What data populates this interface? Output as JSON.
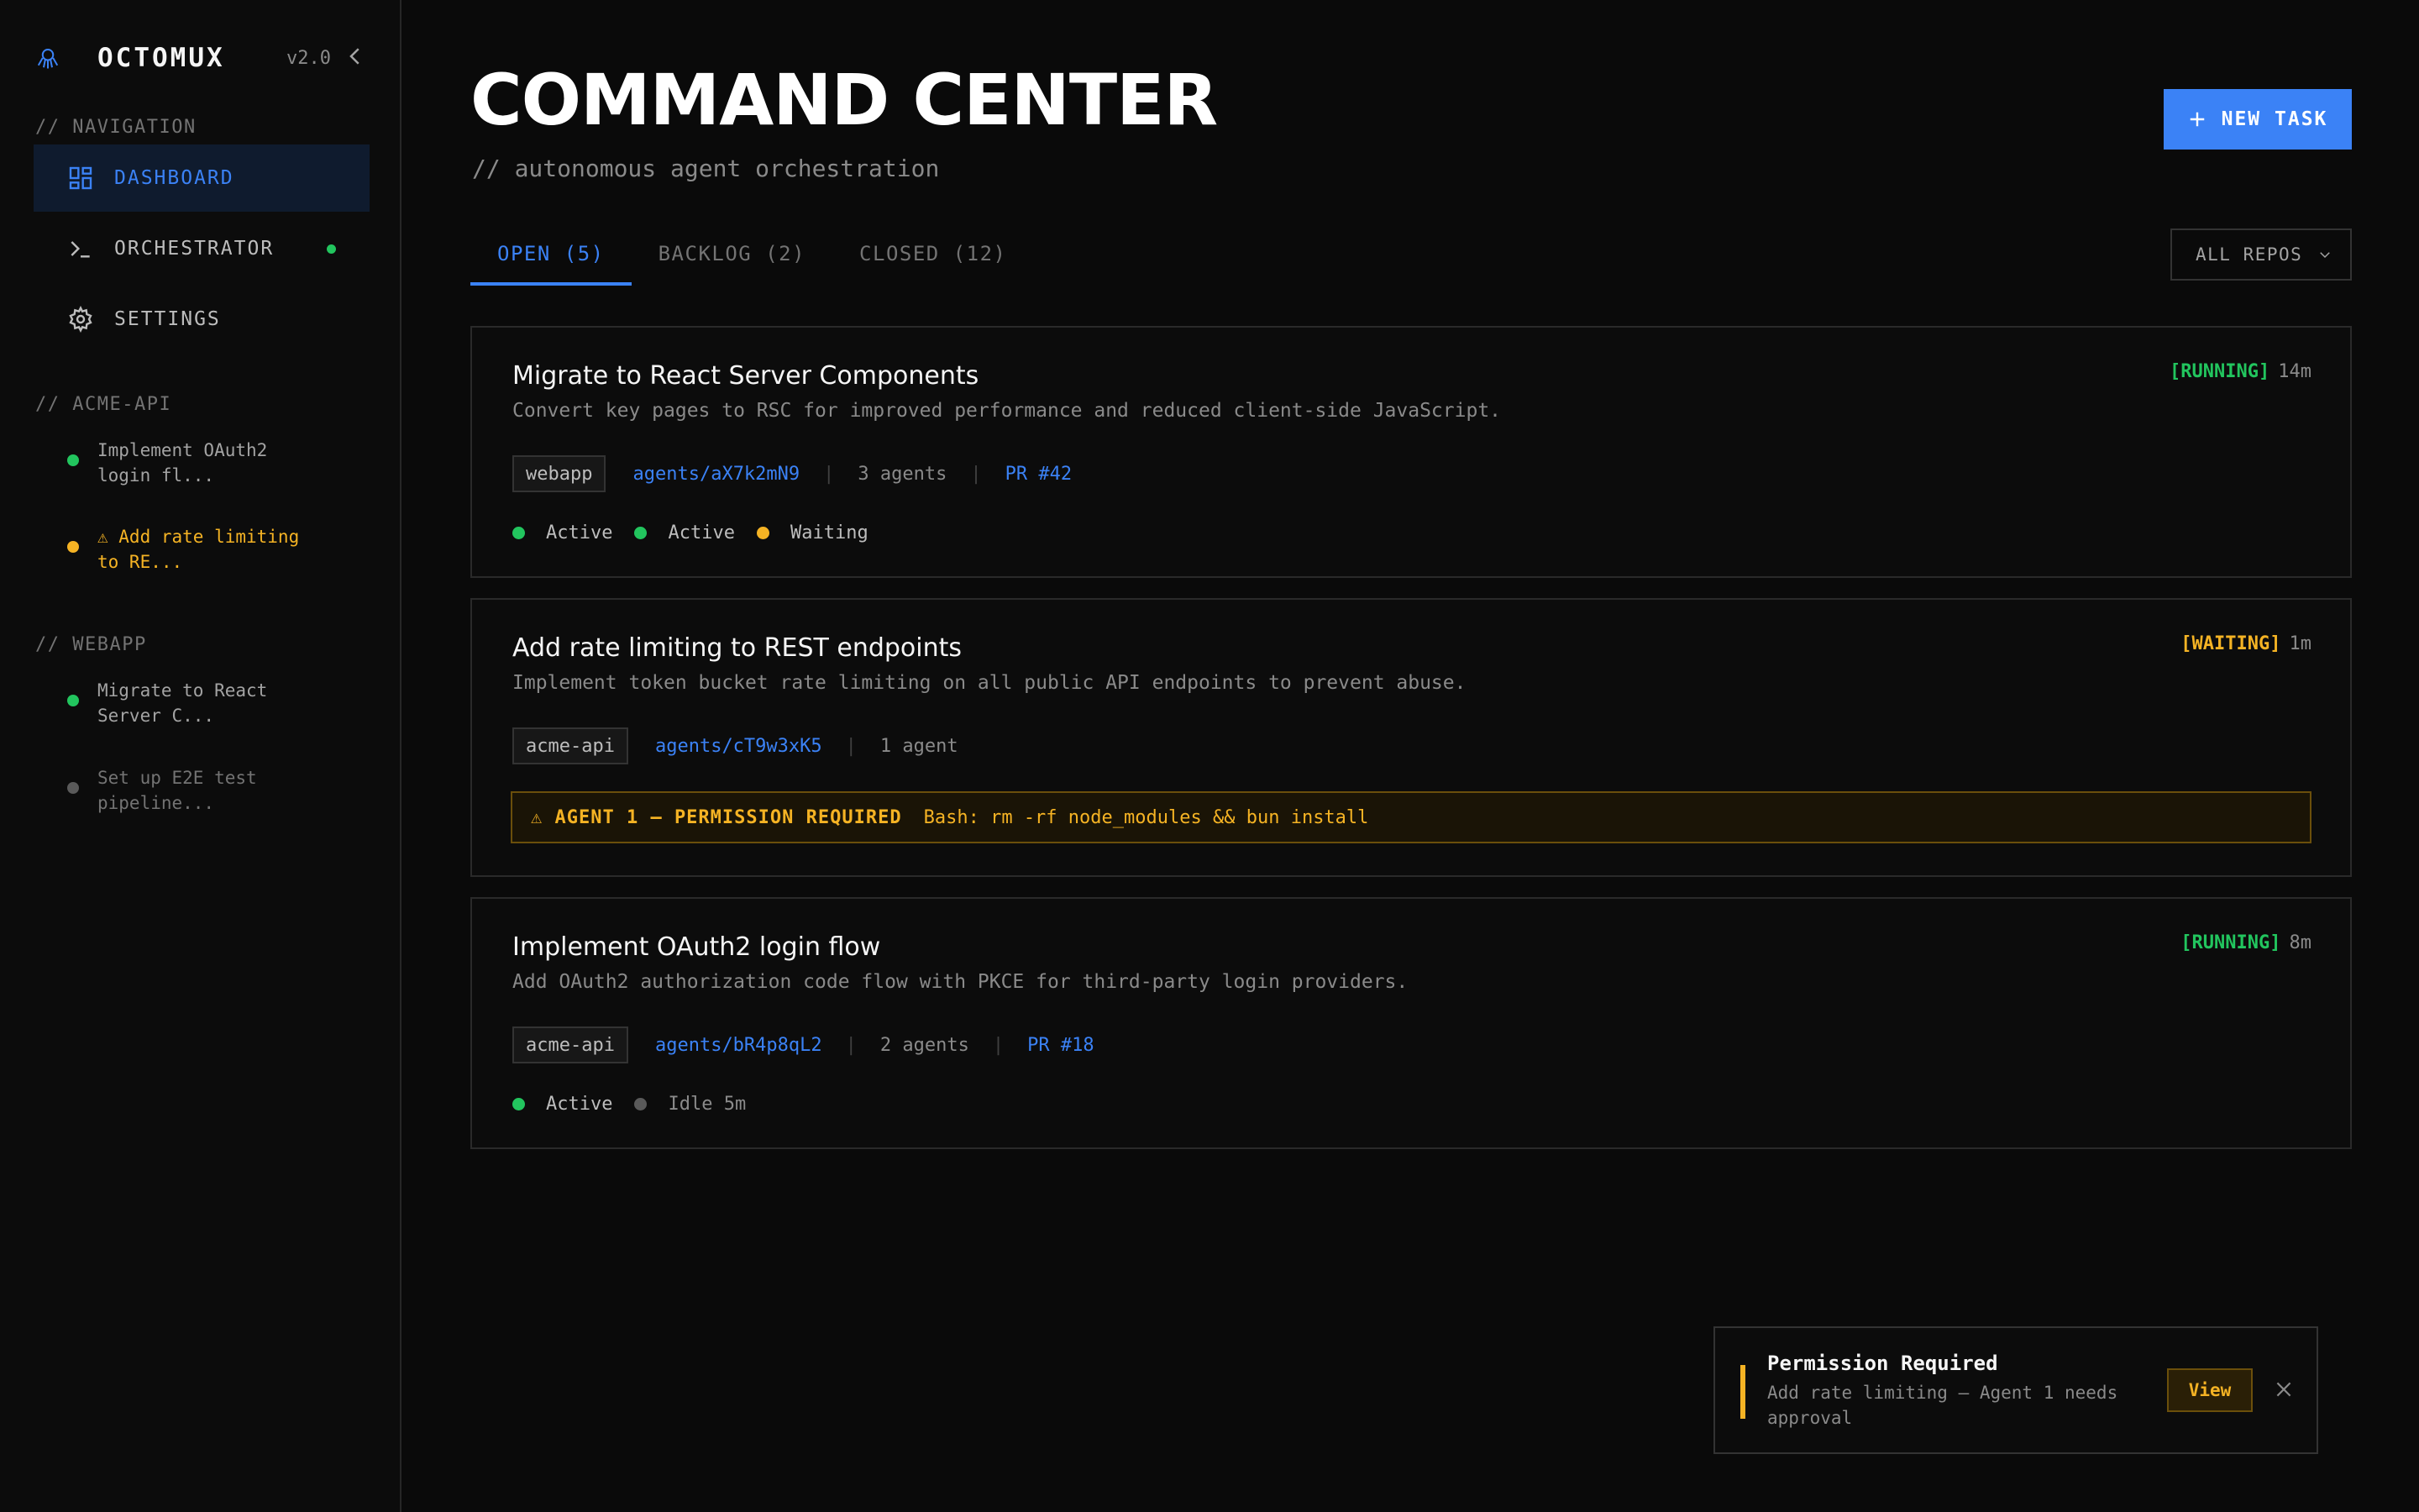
{
  "colors": {
    "accent": "#3b82f6",
    "running": "#22c55e",
    "waiting": "#f5b324",
    "idle": "#737373",
    "background": "#0a0a0a"
  },
  "sidebar": {
    "brand": "OCTOMUX",
    "version": "v2.0",
    "nav_label": "// NAVIGATION",
    "nav": [
      {
        "label": "DASHBOARD",
        "icon": "dashboard-icon",
        "active": true
      },
      {
        "label": "ORCHESTRATOR",
        "icon": "terminal-icon",
        "active": false
      },
      {
        "label": "SETTINGS",
        "icon": "gear-icon",
        "active": false
      }
    ],
    "groups": [
      {
        "label": "// ACME-API",
        "tasks": [
          {
            "label": "Implement OAuth2\nlogin fl...",
            "status": "running"
          },
          {
            "label": "⚠ Add rate limiting\nto RE...",
            "status": "waiting"
          }
        ]
      },
      {
        "label": "// WEBAPP",
        "tasks": [
          {
            "label": "Migrate to React\nServer C...",
            "status": "running"
          },
          {
            "label": "Set up E2E test\npipeline...",
            "status": "idle"
          }
        ]
      }
    ]
  },
  "header": {
    "title": "COMMAND CENTER",
    "subtitle": "// autonomous agent orchestration",
    "new_task_label": "NEW TASK"
  },
  "tabs": [
    {
      "label": "OPEN (5)",
      "active": true
    },
    {
      "label": "BACKLOG (2)",
      "active": false
    },
    {
      "label": "CLOSED (12)",
      "active": false
    }
  ],
  "repo_filter": "ALL REPOS",
  "tasks": [
    {
      "title": "Migrate to React Server Components",
      "description": "Convert key pages to RSC for improved performance and reduced client-side JavaScript.",
      "status": "[RUNNING]",
      "time": "14m",
      "repo": "webapp",
      "agent_path": "agents/aX7k2mN9",
      "agent_count": "3 agents",
      "pr": "PR #42",
      "agents": [
        {
          "label": "Active",
          "state": "running"
        },
        {
          "label": "Active",
          "state": "running"
        },
        {
          "label": "Waiting",
          "state": "waiting"
        }
      ]
    },
    {
      "title": "Add rate limiting to REST endpoints",
      "description": "Implement token bucket rate limiting on all public API endpoints to prevent abuse.",
      "status": "[WAITING]",
      "time": "1m",
      "repo": "acme-api",
      "agent_path": "agents/cT9w3xK5",
      "agent_count": "1 agent",
      "permission": {
        "label": "⚠ AGENT 1 — PERMISSION REQUIRED",
        "command": "Bash: rm -rf node_modules && bun install"
      }
    },
    {
      "title": "Implement OAuth2 login flow",
      "description": "Add OAuth2 authorization code flow with PKCE for third-party login providers.",
      "status": "[RUNNING]",
      "time": "8m",
      "repo": "acme-api",
      "agent_path": "agents/bR4p8qL2",
      "agent_count": "2 agents",
      "pr": "PR #18",
      "agents": [
        {
          "label": "Active",
          "state": "running"
        },
        {
          "label": "Idle 5m",
          "state": "idle"
        }
      ]
    }
  ],
  "toast": {
    "title": "Permission Required",
    "body": "Add rate limiting — Agent 1 needs approval",
    "action": "View"
  }
}
